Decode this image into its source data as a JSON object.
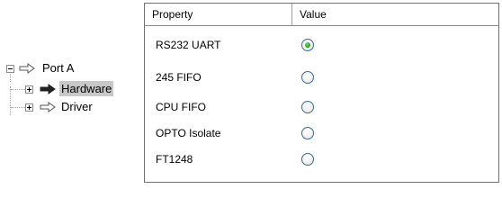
{
  "tree": {
    "nodes": [
      {
        "label": "Port A",
        "expander": "minus",
        "icon": "outline-arrow-icon",
        "selected": false
      },
      {
        "label": "Hardware",
        "expander": "plus",
        "icon": "filled-arrow-icon",
        "selected": true
      },
      {
        "label": "Driver",
        "expander": "plus",
        "icon": "outline-arrow-icon",
        "selected": false
      }
    ]
  },
  "grid": {
    "headers": {
      "property": "Property",
      "value": "Value"
    },
    "rows": [
      {
        "property": "RS232 UART",
        "checked": true
      },
      {
        "property": "245 FIFO",
        "checked": false
      },
      {
        "property": "CPU FIFO",
        "checked": false
      },
      {
        "property": "OPTO Isolate",
        "checked": false
      },
      {
        "property": "FT1248",
        "checked": false
      }
    ]
  },
  "colors": {
    "selection": "#c8c8c8",
    "radio_border": "#3c6a8c",
    "radio_checked": "#1a9a1a",
    "grid_border": "#707070"
  }
}
